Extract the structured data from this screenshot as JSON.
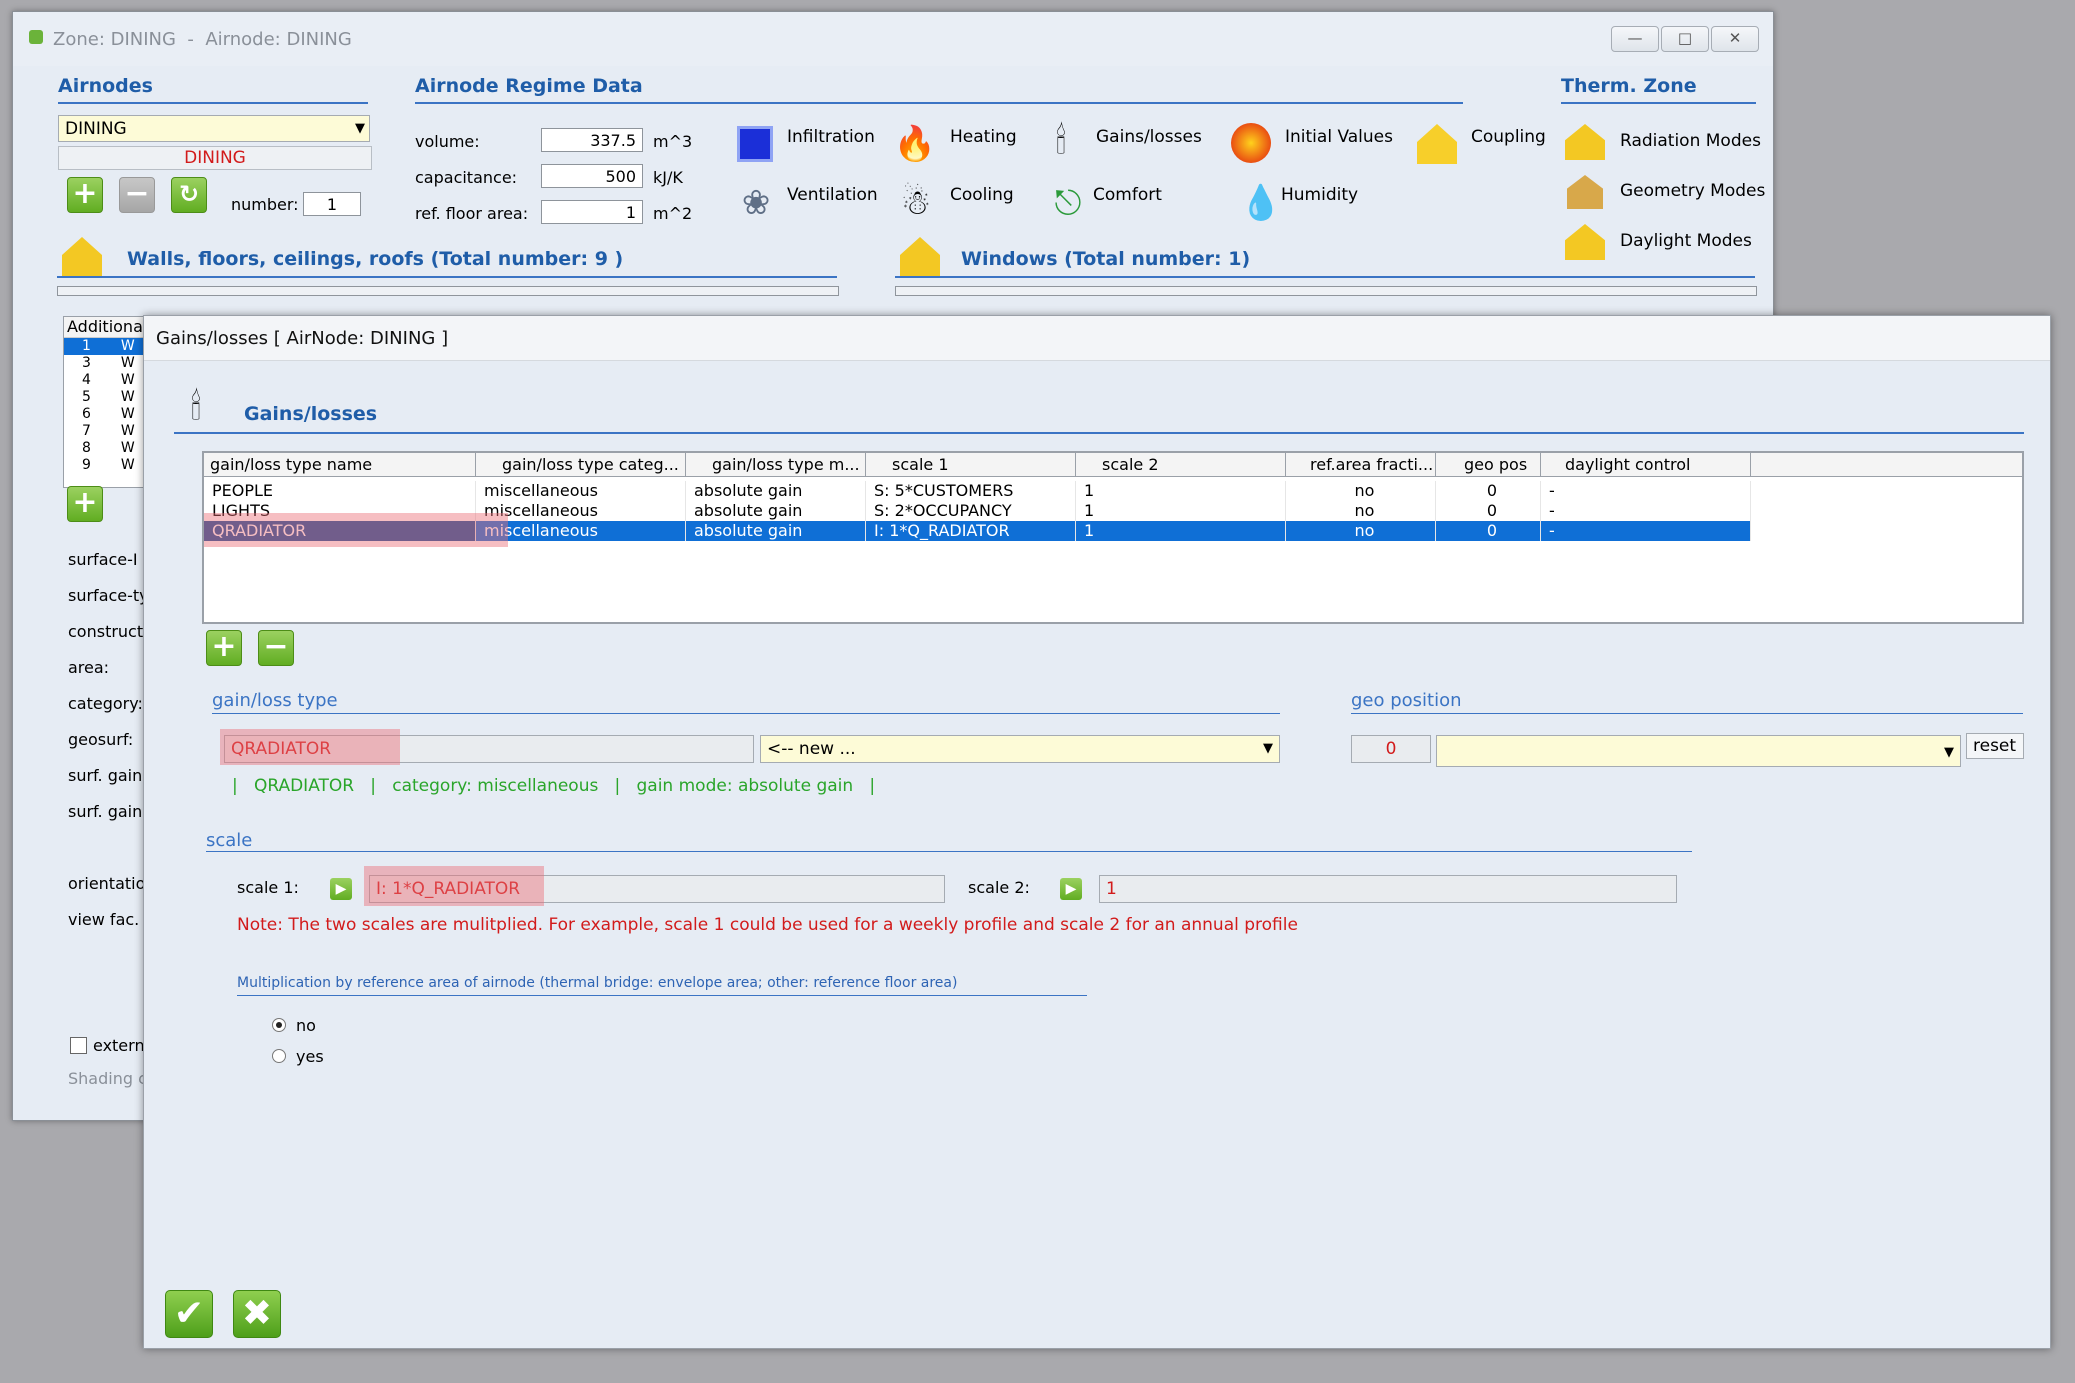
{
  "main_window": {
    "title": "Zone: DINING  -  Airnode: DINING",
    "airnodes": {
      "heading": "Airnodes",
      "selected": "DINING",
      "name_display": "DINING",
      "number_label": "number:",
      "number_value": "1"
    },
    "regime": {
      "heading": "Airnode Regime Data",
      "volume_label": "volume:",
      "volume_value": "337.5",
      "volume_unit": "m^3",
      "capacitance_label": "capacitance:",
      "capacitance_value": "500",
      "capacitance_unit": "kJ/K",
      "floor_label": "ref. floor area:",
      "floor_value": "1",
      "floor_unit": "m^2"
    },
    "toolbar": [
      {
        "label": "Infiltration",
        "icon": "infiltration-icon"
      },
      {
        "label": "Heating",
        "icon": "flame-icon"
      },
      {
        "label": "Gains/losses",
        "icon": "candle-icon"
      },
      {
        "label": "Initial Values",
        "icon": "initial-values-icon"
      },
      {
        "label": "Coupling",
        "icon": "coupling-icon"
      },
      {
        "label": "Ventilation",
        "icon": "fan-icon"
      },
      {
        "label": "Cooling",
        "icon": "snowman-icon"
      },
      {
        "label": "Comfort",
        "icon": "lounger-icon"
      },
      {
        "label": "Humidity",
        "icon": "droplets-icon"
      }
    ],
    "therm_zone": {
      "heading": "Therm. Zone",
      "radiation": "Radiation Modes",
      "geometry": "Geometry Modes",
      "daylight": "Daylight Modes"
    },
    "walls_heading": "Walls, floors, ceilings, roofs (Total number: 9 )",
    "windows_heading": "Windows (Total number: 1)",
    "surface_list": {
      "header": "Additional",
      "rows": [
        "1",
        "3",
        "4",
        "5",
        "6",
        "7",
        "8",
        "9"
      ],
      "row_prefix": "W"
    },
    "left_labels": [
      "surface-I",
      "surface-ty",
      "constructi",
      "area:",
      "category:",
      "geosurf:",
      "surf. gain",
      "surf. gain",
      "orientatio",
      "view fac."
    ],
    "extern_label": "extern",
    "shading_label": "Shading c"
  },
  "dialog": {
    "title": "Gains/losses [ AirNode: DINING ]",
    "heading": "Gains/losses",
    "columns": [
      "gain/loss type name",
      "gain/loss type categ...",
      "gain/loss type m...",
      "scale 1",
      "scale 2",
      "ref.area fracti...",
      "geo pos",
      "daylight control"
    ],
    "rows": [
      {
        "name": "PEOPLE",
        "category": "miscellaneous",
        "mode": "absolute gain",
        "scale1": "S: 5*CUSTOMERS",
        "scale2": "1",
        "refarea": "no",
        "geopos": "0",
        "daylight": "-"
      },
      {
        "name": "LIGHTS",
        "category": "miscellaneous",
        "mode": "absolute gain",
        "scale1": "S: 2*OCCUPANCY",
        "scale2": "1",
        "refarea": "no",
        "geopos": "0",
        "daylight": "-"
      },
      {
        "name": "QRADIATOR",
        "category": "miscellaneous",
        "mode": "absolute gain",
        "scale1": "I: 1*Q_RADIATOR",
        "scale2": "1",
        "refarea": "no",
        "geopos": "0",
        "daylight": "-"
      }
    ],
    "gain_type": {
      "heading": "gain/loss type",
      "name_value": "QRADIATOR",
      "dropdown_value": "<-- new ...",
      "info_name": "QRADIATOR",
      "info_category": "category: miscellaneous",
      "info_mode": "gain mode: absolute gain"
    },
    "geo": {
      "heading": "geo position",
      "value": "0",
      "reset_label": "reset"
    },
    "scale": {
      "heading": "scale",
      "scale1_label": "scale 1:",
      "scale1_value": "I: 1*Q_RADIATOR",
      "scale2_label": "scale 2:",
      "scale2_value": "1",
      "note": "Note: The two scales are mulitplied. For example, scale 1 could be used for a weekly profile and scale 2 for an annual profile"
    },
    "multiplication": {
      "heading": "Multiplication by reference area of airnode (thermal bridge: envelope area; other: reference floor area)",
      "option_no": "no",
      "option_yes": "yes",
      "selected": "no"
    }
  }
}
